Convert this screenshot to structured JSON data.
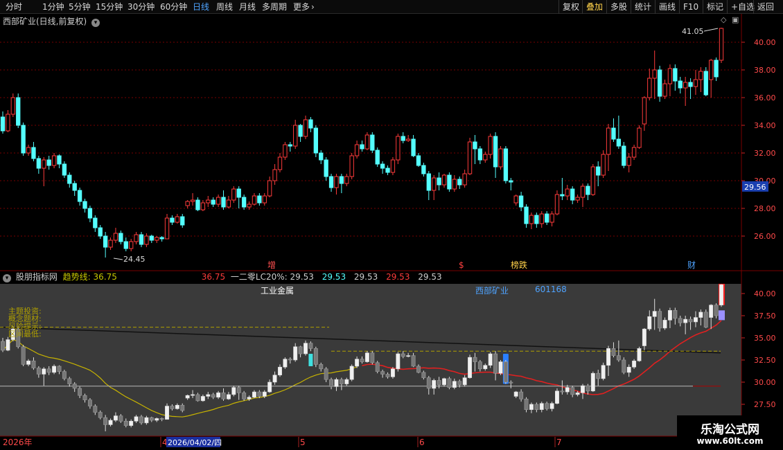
{
  "toolbar": {
    "left": [
      "分时",
      "1分钟",
      "5分钟",
      "15分钟",
      "30分钟",
      "60分钟",
      "日线",
      "周线",
      "月线",
      "多周期",
      "更多"
    ],
    "active": "日线",
    "right": [
      "复权",
      "叠加",
      "多股",
      "统计",
      "画线",
      "F10",
      "标记",
      "+自选",
      "返回"
    ],
    "right_highlight": "叠加"
  },
  "price_panel": {
    "title": "西部矿业(日线,前复权)",
    "y_ticks": [
      "40.00",
      "38.00",
      "36.00",
      "34.00",
      "32.00",
      "30.00",
      "28.00",
      "26.00"
    ],
    "current_price": "29.56",
    "high_label": "41.05",
    "low_label": "24.45",
    "event_marks": [
      "增",
      "$",
      "榜跌",
      "财"
    ]
  },
  "indicator_panel": {
    "name": "股朋指标网",
    "trend_label": "趋势线:",
    "trend_value": "36.75",
    "values": [
      "36.75",
      "一二零LC20%:",
      "29.53",
      "29.53",
      "29.53",
      "29.53",
      "29.53"
    ],
    "overlay_title": "工业金属",
    "stock_name": "西部矿业",
    "stock_code": "601168",
    "legend_lines": [
      "主题投资:",
      "概念题材:",
      "风险提示:",
      "区间最低:"
    ],
    "y_ticks": [
      "40.00",
      "37.50",
      "35.00",
      "32.50",
      "30.00",
      "27.50"
    ]
  },
  "date_axis": {
    "year": "2026年",
    "months": [
      "4",
      "5",
      "6",
      "7"
    ],
    "cursor_date": "2026/04/02/四"
  },
  "watermark": {
    "line1": "乐淘公式网",
    "line2": "www.60lt.com"
  },
  "colors": {
    "up": "#ff3b3b",
    "down": "#54ffff",
    "grid": "#7a0000",
    "active": "#4ea3ff"
  },
  "chart_data": {
    "type": "candlestick",
    "candles": [
      [
        34.6,
        33.6,
        35.0,
        33.4
      ],
      [
        33.6,
        34.8,
        35.1,
        33.5
      ],
      [
        34.8,
        36.0,
        36.3,
        34.6
      ],
      [
        36.0,
        34.0,
        36.3,
        33.8
      ],
      [
        34.0,
        32.0,
        34.2,
        31.8
      ],
      [
        32.0,
        32.4,
        32.6,
        31.8
      ],
      [
        32.4,
        31.6,
        32.8,
        31.4
      ],
      [
        31.6,
        30.9,
        31.8,
        30.5
      ],
      [
        30.9,
        31.5,
        31.7,
        29.6
      ],
      [
        31.5,
        31.1,
        31.8,
        30.8
      ],
      [
        31.1,
        31.8,
        32.0,
        30.9
      ],
      [
        31.8,
        31.2,
        31.9,
        30.9
      ],
      [
        31.2,
        30.4,
        31.4,
        30.2
      ],
      [
        30.4,
        29.8,
        30.6,
        29.5
      ],
      [
        29.8,
        29.3,
        30.0,
        28.9
      ],
      [
        29.3,
        28.5,
        29.5,
        28.2
      ],
      [
        28.5,
        28.0,
        28.7,
        27.7
      ],
      [
        28.0,
        27.3,
        28.2,
        27.0
      ],
      [
        27.3,
        26.6,
        27.5,
        26.3
      ],
      [
        26.6,
        26.0,
        26.8,
        25.8
      ],
      [
        26.0,
        25.2,
        26.3,
        24.45
      ],
      [
        25.2,
        25.7,
        25.9,
        25.0
      ],
      [
        25.7,
        26.2,
        26.6,
        25.5
      ],
      [
        26.2,
        25.6,
        26.4,
        25.4
      ],
      [
        25.6,
        25.1,
        25.9,
        24.9
      ],
      [
        25.1,
        25.6,
        25.8,
        24.9
      ],
      [
        25.6,
        26.1,
        26.3,
        25.4
      ],
      [
        26.1,
        25.4,
        26.3,
        25.2
      ],
      [
        25.4,
        26.0,
        26.2,
        25.2
      ],
      [
        26.0,
        25.7,
        26.1,
        25.5
      ],
      [
        25.7,
        25.9,
        26.0,
        25.5
      ],
      [
        25.9,
        25.8,
        26.0,
        25.6
      ],
      [
        25.8,
        27.3,
        27.6,
        25.8
      ],
      [
        27.3,
        27.0,
        27.5,
        26.8
      ],
      [
        27.0,
        27.4,
        27.6,
        26.9
      ],
      [
        27.4,
        26.8,
        27.6,
        26.6
      ],
      [
        28.2,
        28.5,
        28.6,
        28.0
      ],
      [
        28.5,
        28.6,
        29.1,
        28.2
      ],
      [
        28.6,
        27.9,
        28.8,
        27.8
      ],
      [
        27.9,
        28.4,
        28.6,
        27.8
      ],
      [
        28.4,
        28.6,
        28.9,
        28.1
      ],
      [
        28.6,
        28.3,
        28.8,
        28.1
      ],
      [
        28.3,
        28.8,
        29.0,
        28.1
      ],
      [
        28.8,
        28.1,
        29.3,
        27.9
      ],
      [
        28.1,
        28.6,
        28.9,
        28.0
      ],
      [
        28.6,
        29.4,
        29.6,
        28.4
      ],
      [
        29.4,
        28.8,
        29.6,
        28.0
      ],
      [
        28.8,
        28.1,
        29.0,
        27.9
      ],
      [
        28.1,
        28.3,
        28.5,
        27.9
      ],
      [
        28.3,
        28.9,
        29.1,
        28.2
      ],
      [
        28.9,
        28.4,
        29.1,
        28.2
      ],
      [
        28.4,
        28.9,
        29.1,
        28.2
      ],
      [
        28.9,
        30.0,
        30.3,
        28.8
      ],
      [
        30.0,
        30.8,
        31.2,
        29.7
      ],
      [
        30.8,
        31.7,
        32.0,
        30.6
      ],
      [
        31.7,
        32.6,
        32.8,
        31.5
      ],
      [
        32.6,
        32.5,
        32.8,
        32.1
      ],
      [
        32.5,
        34.0,
        34.4,
        32.3
      ],
      [
        34.0,
        33.2,
        34.1,
        32.8
      ],
      [
        33.2,
        34.4,
        34.7,
        33.0
      ],
      [
        34.4,
        33.8,
        34.6,
        33.5
      ],
      [
        33.8,
        32.0,
        34.0,
        31.7
      ],
      [
        32.0,
        31.5,
        32.2,
        31.2
      ],
      [
        31.5,
        30.3,
        31.7,
        30.0
      ],
      [
        30.3,
        29.5,
        30.5,
        29.2
      ],
      [
        29.5,
        30.3,
        30.5,
        29.0
      ],
      [
        30.3,
        29.8,
        30.5,
        29.1
      ],
      [
        29.8,
        30.3,
        30.5,
        29.6
      ],
      [
        30.3,
        31.8,
        32.0,
        30.1
      ],
      [
        31.8,
        32.6,
        32.9,
        31.6
      ],
      [
        32.6,
        32.3,
        32.9,
        32.1
      ],
      [
        32.3,
        33.3,
        33.5,
        32.2
      ],
      [
        33.3,
        32.2,
        33.5,
        32.0
      ],
      [
        32.2,
        31.2,
        32.4,
        31.0
      ],
      [
        31.2,
        30.9,
        31.4,
        30.5
      ],
      [
        30.9,
        30.6,
        31.1,
        30.4
      ],
      [
        30.6,
        31.5,
        31.7,
        30.4
      ],
      [
        31.5,
        33.2,
        33.4,
        31.2
      ],
      [
        33.2,
        32.9,
        33.5,
        32.7
      ],
      [
        32.9,
        33.0,
        33.3,
        32.8
      ],
      [
        33.0,
        31.8,
        33.3,
        31.7
      ],
      [
        31.8,
        31.1,
        32.0,
        31.0
      ],
      [
        31.1,
        30.5,
        31.3,
        30.3
      ],
      [
        30.5,
        29.3,
        30.7,
        28.6
      ],
      [
        29.3,
        30.2,
        30.4,
        28.6
      ],
      [
        30.2,
        29.7,
        30.6,
        29.3
      ],
      [
        29.7,
        30.4,
        30.5,
        29.5
      ],
      [
        30.4,
        29.4,
        30.6,
        29.2
      ],
      [
        29.4,
        30.1,
        30.4,
        29.2
      ],
      [
        30.1,
        29.7,
        30.3,
        29.4
      ],
      [
        29.7,
        30.5,
        30.8,
        29.5
      ],
      [
        30.5,
        32.8,
        33.1,
        30.4
      ],
      [
        32.8,
        32.3,
        33.3,
        31.2
      ],
      [
        32.3,
        31.5,
        32.5,
        31.2
      ],
      [
        31.5,
        31.9,
        32.1,
        31.3
      ],
      [
        31.9,
        33.2,
        33.4,
        31.6
      ],
      [
        33.2,
        31.0,
        33.5,
        30.2
      ],
      [
        31.0,
        32.3,
        32.5,
        30.8
      ],
      [
        32.3,
        30.0,
        32.5,
        29.8
      ],
      [
        30.0,
        29.9,
        30.2,
        29.3
      ],
      [
        28.4,
        28.9,
        29.0,
        28.2
      ],
      [
        28.9,
        28.1,
        29.2,
        27.8
      ],
      [
        28.1,
        26.9,
        28.3,
        26.6
      ],
      [
        26.9,
        27.5,
        27.7,
        26.5
      ],
      [
        27.5,
        26.9,
        27.7,
        26.6
      ],
      [
        26.9,
        27.6,
        27.8,
        26.6
      ],
      [
        27.6,
        27.0,
        27.8,
        26.8
      ],
      [
        27.0,
        27.6,
        27.8,
        26.7
      ],
      [
        27.6,
        29.0,
        29.3,
        27.5
      ],
      [
        29.0,
        28.9,
        30.2,
        28.6
      ],
      [
        28.9,
        29.4,
        29.7,
        28.6
      ],
      [
        29.4,
        28.6,
        29.6,
        28.3
      ],
      [
        28.6,
        28.8,
        29.0,
        28.4
      ],
      [
        28.8,
        29.6,
        29.8,
        28.1
      ],
      [
        29.6,
        29.0,
        29.8,
        28.6
      ],
      [
        29.0,
        31.0,
        31.2,
        28.9
      ],
      [
        31.0,
        30.4,
        31.4,
        29.6
      ],
      [
        30.4,
        31.9,
        32.2,
        30.2
      ],
      [
        31.9,
        33.8,
        34.1,
        30.7
      ],
      [
        33.8,
        33.0,
        34.5,
        32.8
      ],
      [
        33.0,
        32.5,
        34.7,
        32.3
      ],
      [
        32.5,
        31.1,
        32.8,
        30.9
      ],
      [
        31.1,
        31.7,
        32.0,
        30.6
      ],
      [
        31.7,
        32.4,
        32.6,
        31.5
      ],
      [
        32.4,
        33.8,
        34.0,
        32.3
      ],
      [
        34.1,
        36.0,
        36.1,
        33.6
      ],
      [
        36.0,
        37.4,
        38.1,
        35.8
      ],
      [
        37.4,
        38.0,
        39.4,
        35.9
      ],
      [
        38.0,
        36.1,
        38.3,
        35.7
      ],
      [
        36.1,
        37.0,
        37.3,
        35.9
      ],
      [
        37.0,
        38.1,
        38.4,
        36.1
      ],
      [
        38.1,
        37.2,
        38.4,
        36.5
      ],
      [
        37.2,
        36.7,
        37.5,
        36.3
      ],
      [
        36.7,
        37.1,
        37.5,
        35.4
      ],
      [
        37.1,
        36.8,
        37.4,
        35.9
      ],
      [
        36.8,
        37.3,
        38.0,
        36.2
      ],
      [
        37.3,
        37.9,
        38.2,
        36.4
      ],
      [
        37.9,
        36.2,
        38.2,
        36.1
      ],
      [
        37.3,
        38.7,
        38.8,
        36.0
      ],
      [
        38.7,
        37.5,
        38.9,
        37.2
      ],
      [
        38.7,
        41.0,
        41.05,
        38.5
      ]
    ]
  }
}
